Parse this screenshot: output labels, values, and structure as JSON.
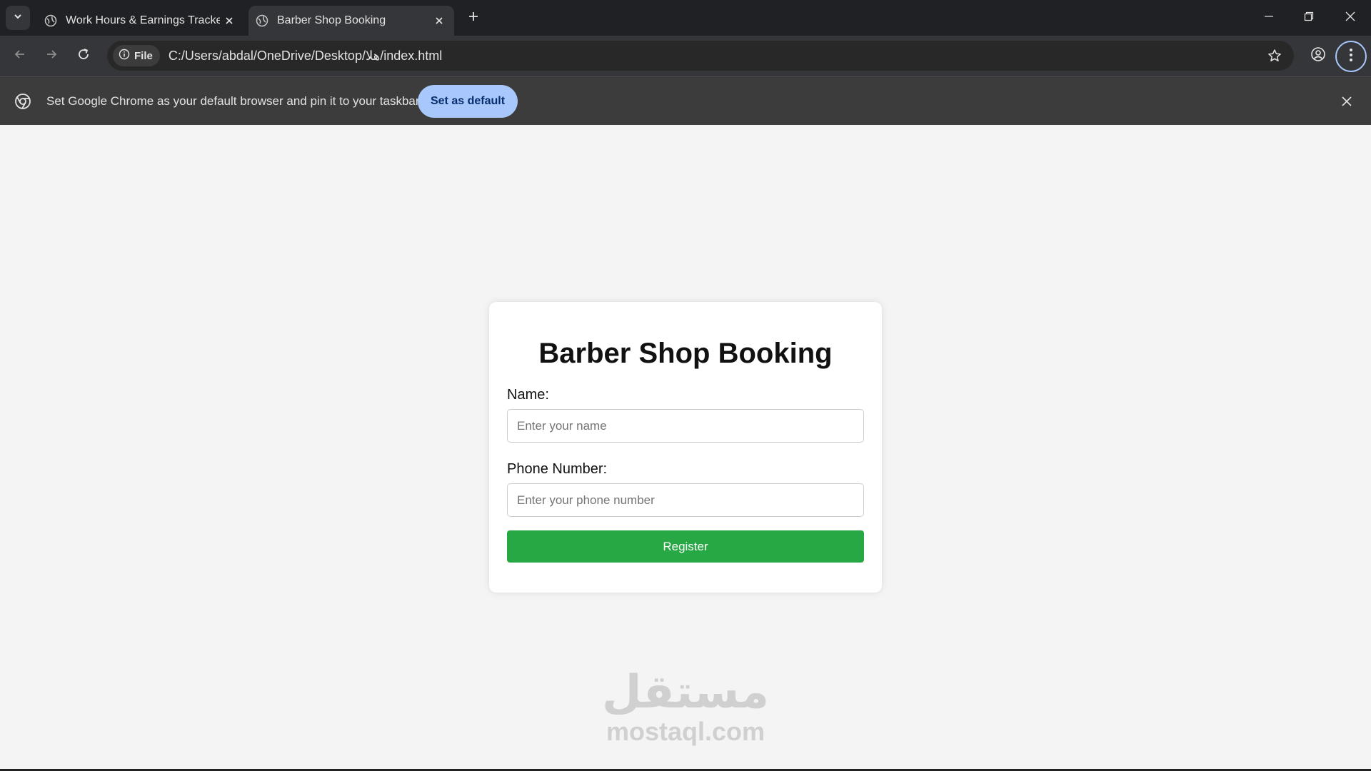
{
  "browser": {
    "tabs": [
      {
        "title": "Work Hours & Earnings Tracker",
        "active": false
      },
      {
        "title": "Barber Shop Booking",
        "active": true
      }
    ],
    "address_chip": "File",
    "url": "C:/Users/abdal/OneDrive/Desktop/هلا/index.html",
    "infobar": {
      "message": "Set Google Chrome as your default browser and pin it to your taskbar",
      "button": "Set as default"
    },
    "colors": {
      "accent": "#a8c7fa",
      "frame": "#202124",
      "toolbar": "#35363a"
    }
  },
  "form": {
    "title": "Barber Shop Booking",
    "name_label": "Name:",
    "name_placeholder": "Enter your name",
    "phone_label": "Phone Number:",
    "phone_placeholder": "Enter your phone number",
    "submit": "Register",
    "submit_color": "#28a745"
  },
  "watermark": {
    "logo": "مستقل",
    "url": "mostaql.com"
  }
}
